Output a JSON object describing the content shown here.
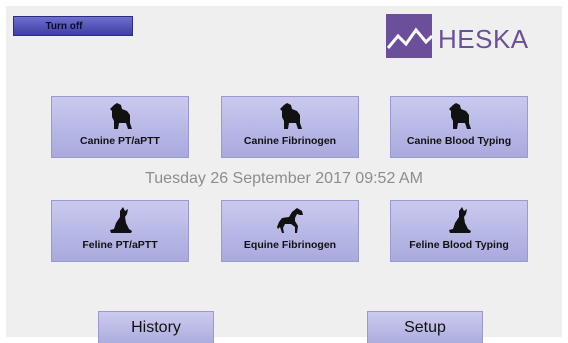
{
  "turn_off_label": "Turn off",
  "brand": {
    "name": "HESKA",
    "accent": "#6b4f9b"
  },
  "datetime": "Tuesday 26 September 2017 09:52 AM",
  "tests": [
    {
      "label": "Canine PT/aPTT",
      "icon": "dog-icon"
    },
    {
      "label": "Canine Fibrinogen",
      "icon": "dog-icon"
    },
    {
      "label": "Canine Blood Typing",
      "icon": "dog-icon"
    },
    {
      "label": "Feline PT/aPTT",
      "icon": "cat-icon"
    },
    {
      "label": "Equine Fibrinogen",
      "icon": "horse-icon"
    },
    {
      "label": "Feline Blood Typing",
      "icon": "cat-icon"
    }
  ],
  "footer": {
    "history_label": "History",
    "setup_label": "Setup"
  },
  "colors": {
    "button": "#b9b9e6",
    "turn_off": "#4a4ab0",
    "background": "#efefef",
    "date_text": "#8d8d8d"
  }
}
